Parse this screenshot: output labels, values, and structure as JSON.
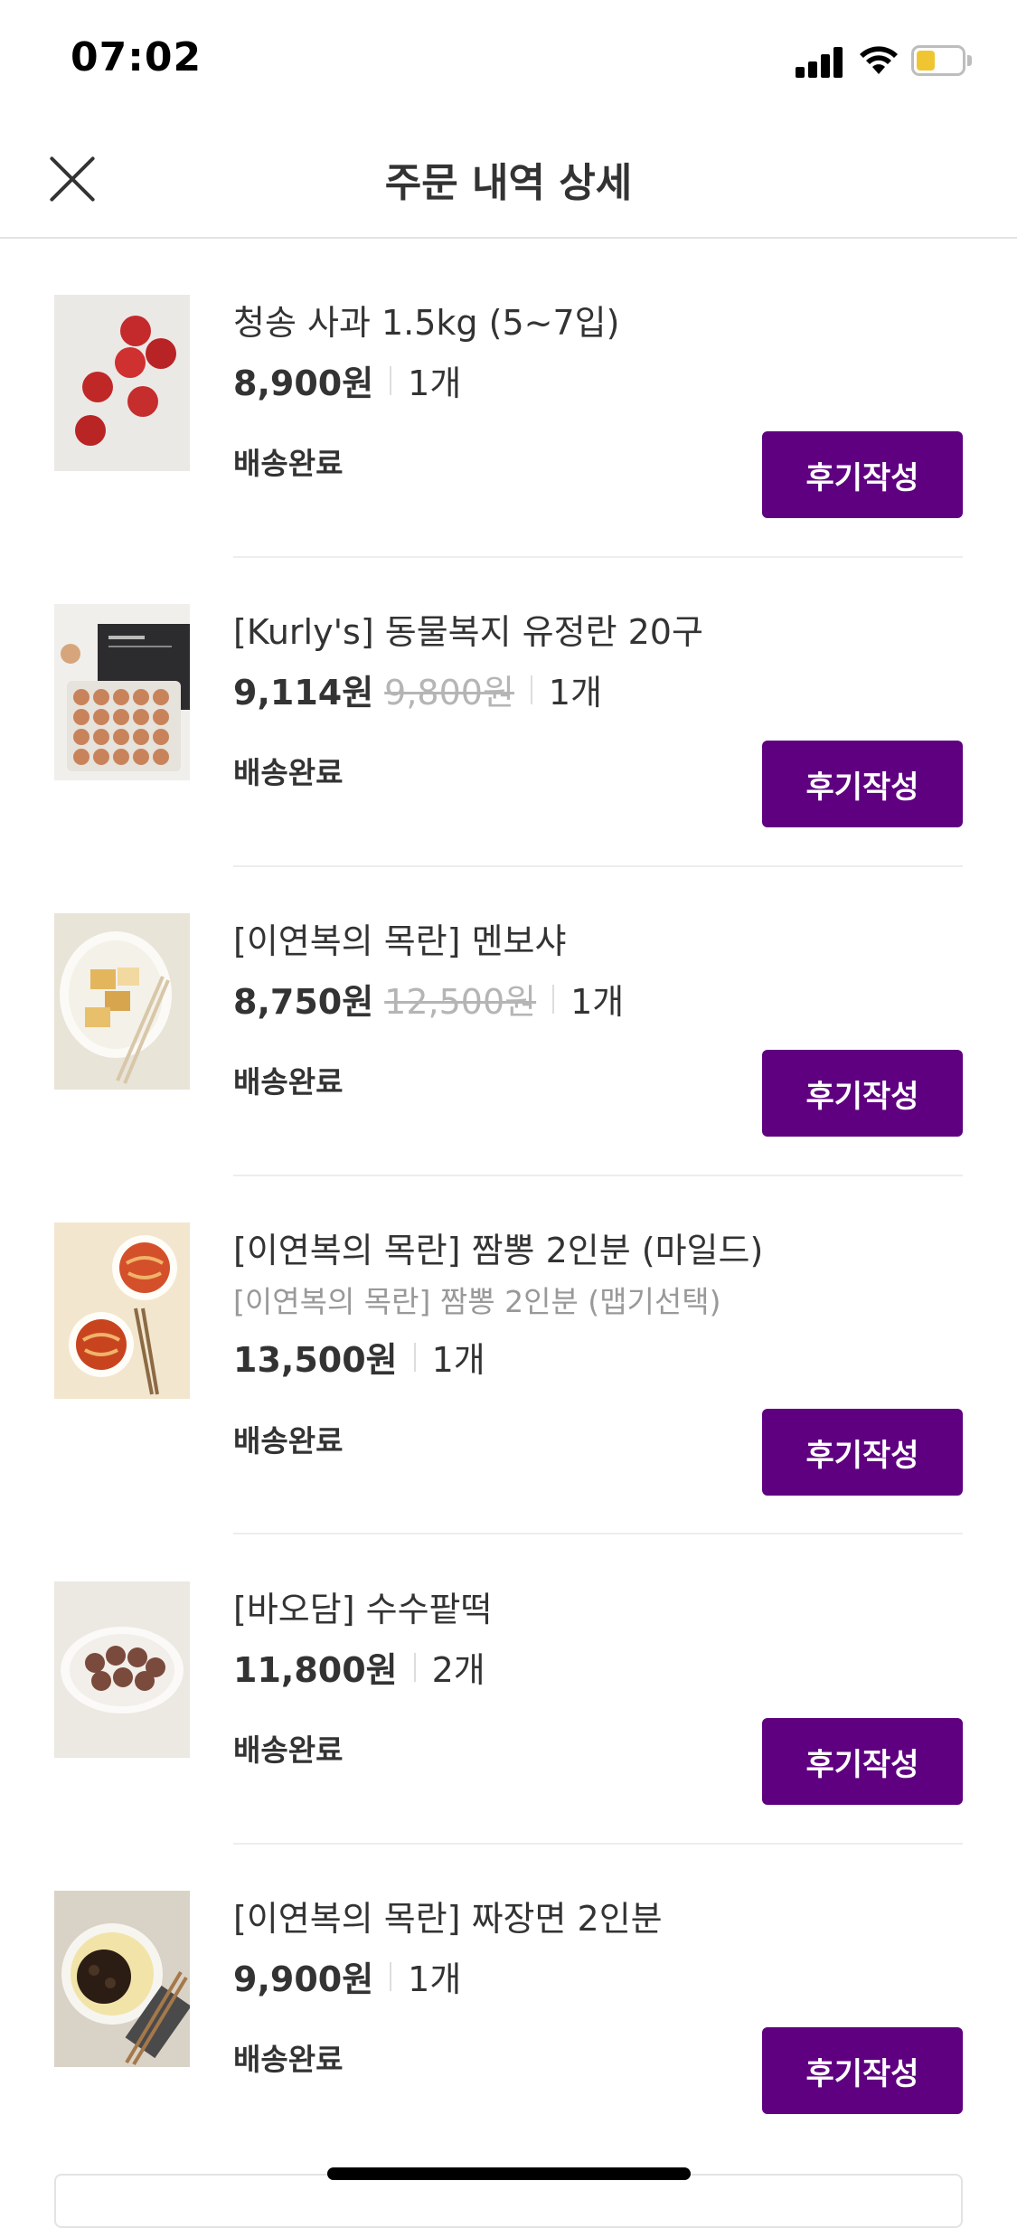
{
  "status_bar": {
    "time": "07:02",
    "battery_color": "#f0c532"
  },
  "header": {
    "title": "주문 내역 상세",
    "close_icon": "close-icon"
  },
  "colors": {
    "accent": "#5f0080",
    "text": "#333333",
    "muted": "#999999",
    "strike": "#b5b5b5"
  },
  "items": [
    {
      "name": "청송 사과 1.5kg (5~7입)",
      "option": "",
      "price": "8,900원",
      "original_price": "",
      "quantity": "1개",
      "status": "배송완료",
      "review_label": "후기작성",
      "thumb": "apples"
    },
    {
      "name": "[Kurly's] 동물복지 유정란 20구",
      "option": "",
      "price": "9,114원",
      "original_price": "9,800원",
      "quantity": "1개",
      "status": "배송완료",
      "review_label": "후기작성",
      "thumb": "eggs"
    },
    {
      "name": "[이연복의 목란] 멘보샤",
      "option": "",
      "price": "8,750원",
      "original_price": "12,500원",
      "quantity": "1개",
      "status": "배송완료",
      "review_label": "후기작성",
      "thumb": "menbosha"
    },
    {
      "name": "[이연복의 목란] 짬뽕 2인분 (마일드)",
      "option": "[이연복의 목란] 짬뽕 2인분 (맵기선택)",
      "price": "13,500원",
      "original_price": "",
      "quantity": "1개",
      "status": "배송완료",
      "review_label": "후기작성",
      "thumb": "jjamppong"
    },
    {
      "name": "[바오담] 수수팥떡",
      "option": "",
      "price": "11,800원",
      "original_price": "",
      "quantity": "2개",
      "status": "배송완료",
      "review_label": "후기작성",
      "thumb": "ricecake"
    },
    {
      "name": "[이연복의 목란] 짜장면 2인분",
      "option": "",
      "price": "9,900원",
      "original_price": "",
      "quantity": "1개",
      "status": "배송완료",
      "review_label": "후기작성",
      "thumb": "jjajang"
    }
  ]
}
